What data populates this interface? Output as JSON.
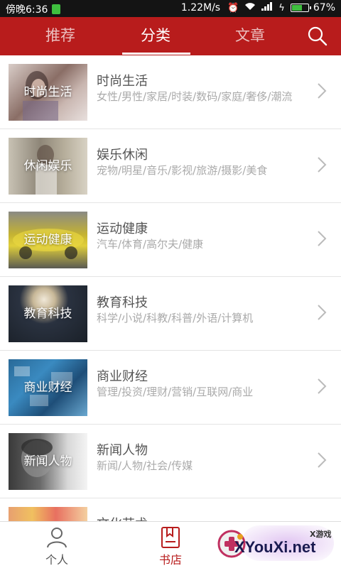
{
  "status_bar": {
    "time": "傍晚6:36",
    "net_speed": "1.22M/s",
    "battery": "67%",
    "battery_level": 0.67
  },
  "header": {
    "tabs": [
      {
        "label": "推荐"
      },
      {
        "label": "分类"
      },
      {
        "label": "文章"
      }
    ],
    "active_tab": 1
  },
  "categories": [
    {
      "thumb_label": "时尚生活",
      "title": "时尚生活",
      "subtitle": "女性/男性/家居/时装/数码/家庭/奢侈/潮流"
    },
    {
      "thumb_label": "休闲娱乐",
      "title": "娱乐休闲",
      "subtitle": "宠物/明星/音乐/影视/旅游/摄影/美食"
    },
    {
      "thumb_label": "运动健康",
      "title": "运动健康",
      "subtitle": "汽车/体育/高尔夫/健康"
    },
    {
      "thumb_label": "教育科技",
      "title": "教育科技",
      "subtitle": "科学/小说/科教/科普/外语/计算机"
    },
    {
      "thumb_label": "商业财经",
      "title": "商业财经",
      "subtitle": "管理/投资/理财/营销/互联网/商业"
    },
    {
      "thumb_label": "新闻人物",
      "title": "新闻人物",
      "subtitle": "新闻/人物/社会/传媒"
    },
    {
      "thumb_label": "",
      "title": "文化艺术",
      "subtitle": ""
    }
  ],
  "bottom_nav": [
    {
      "label": "个人",
      "icon": "person-icon"
    },
    {
      "label": "书店",
      "icon": "bookstore-icon"
    }
  ],
  "watermark": {
    "top_text": "X游戏",
    "text": "XYouXi.net"
  },
  "colors": {
    "brand_red": "#b81c1c",
    "status_bar": "#141414"
  }
}
